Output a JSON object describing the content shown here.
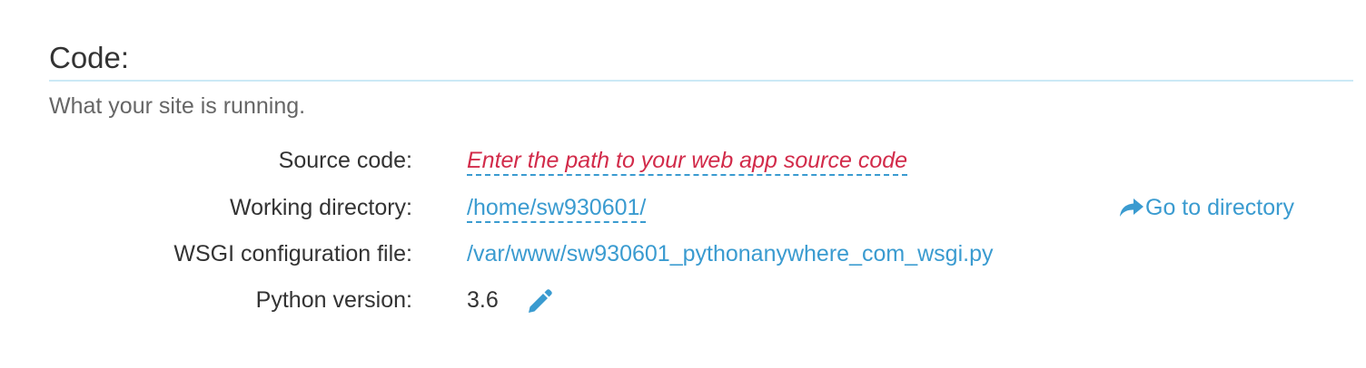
{
  "section": {
    "title": "Code:",
    "description": "What your site is running."
  },
  "rows": {
    "source_code": {
      "label": "Source code:",
      "placeholder": "Enter the path to your web app source code"
    },
    "working_directory": {
      "label": "Working directory:",
      "value": "/home/sw930601/",
      "action_label": "Go to directory",
      "action_icon": "share-arrow-icon"
    },
    "wsgi_file": {
      "label": "WSGI configuration file:",
      "value": "/var/www/sw930601_pythonanywhere_com_wsgi.py"
    },
    "python_version": {
      "label": "Python version:",
      "value": "3.6",
      "edit_icon": "pencil-icon"
    }
  },
  "colors": {
    "link": "#3a9bd0",
    "placeholder": "#d22b4a",
    "rule": "#cbe9f6",
    "text": "#333333",
    "muted": "#666666"
  }
}
